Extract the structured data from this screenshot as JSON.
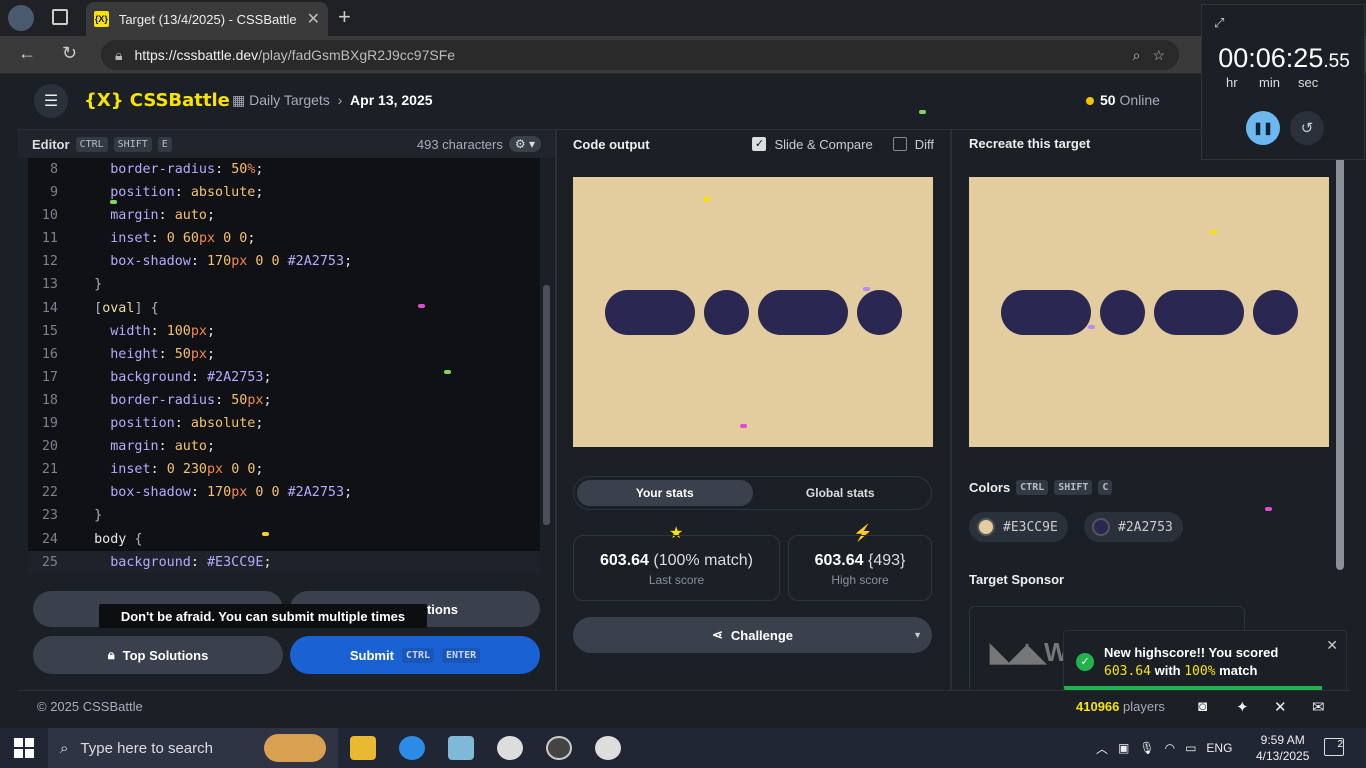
{
  "browser": {
    "tab_title": "Target (13/4/2025) - CSSBattle",
    "tab_favicon": "{X}",
    "url_host": "https://cssbattle.dev",
    "url_path": "/play/fadGsmBXgR2J9cc97SFe"
  },
  "header": {
    "logo": "{X} CSSBattle",
    "crumb_parent": "Daily Targets",
    "crumb_current": "Apr 13, 2025",
    "online_count": "50",
    "online_label": "Online"
  },
  "editor": {
    "title": "Editor",
    "shortcut": [
      "CTRL",
      "SHIFT",
      "E"
    ],
    "char_count": "493 characters",
    "lines": [
      {
        "n": "8",
        "html": "    <span class='c-prop'>border-radius</span>: <span class='c-num'>50</span><span class='c-unit'>%</span>;"
      },
      {
        "n": "9",
        "html": "    <span class='c-prop'>position</span>: <span class='c-num'>absolute</span>;"
      },
      {
        "n": "10",
        "html": "    <span class='c-prop'>margin</span>: <span class='c-num'>auto</span>;"
      },
      {
        "n": "11",
        "html": "    <span class='c-prop'>inset</span>: <span class='c-num'>0</span> <span class='c-num'>60</span><span class='c-unit'>px</span> <span class='c-num'>0</span> <span class='c-num'>0</span>;"
      },
      {
        "n": "12",
        "html": "    <span class='c-prop'>box-shadow</span>: <span class='c-num'>170</span><span class='c-unit'>px</span> <span class='c-num'>0</span> <span class='c-num'>0</span> <span class='c-hex'>#2A2753</span>;"
      },
      {
        "n": "13",
        "html": "  <span class='c-br'>}</span>"
      },
      {
        "n": "14",
        "html": "  <span class='c-br'>[</span><span class='c-sel'>oval</span><span class='c-br'>]</span> <span class='c-br'>{</span>"
      },
      {
        "n": "15",
        "html": "    <span class='c-prop'>width</span>: <span class='c-num'>100</span><span class='c-unit'>px</span>;"
      },
      {
        "n": "16",
        "html": "    <span class='c-prop'>height</span>: <span class='c-num'>50</span><span class='c-unit'>px</span>;"
      },
      {
        "n": "17",
        "html": "    <span class='c-prop'>background</span>: <span class='c-hex'>#2A2753</span>;"
      },
      {
        "n": "18",
        "html": "    <span class='c-prop'>border-radius</span>: <span class='c-num'>50</span><span class='c-unit'>px</span>;"
      },
      {
        "n": "19",
        "html": "    <span class='c-prop'>position</span>: <span class='c-num'>absolute</span>;"
      },
      {
        "n": "20",
        "html": "    <span class='c-prop'>margin</span>: <span class='c-num'>auto</span>;"
      },
      {
        "n": "21",
        "html": "    <span class='c-prop'>inset</span>: <span class='c-num'>0</span> <span class='c-num'>230</span><span class='c-unit'>px</span> <span class='c-num'>0</span> <span class='c-num'>0</span>;"
      },
      {
        "n": "22",
        "html": "    <span class='c-prop'>box-shadow</span>: <span class='c-num'>170</span><span class='c-unit'>px</span> <span class='c-num'>0</span> <span class='c-num'>0</span> <span class='c-hex'>#2A2753</span>;"
      },
      {
        "n": "23",
        "html": "  <span class='c-br'>}</span>"
      },
      {
        "n": "24",
        "html": "  <span class='c-kw'>body</span> <span class='c-br'>{</span>"
      },
      {
        "n": "25",
        "html": "    <span class='c-prop'>background</span>: <span class='c-hex'>#E3CC9E</span>;"
      }
    ],
    "tooltip": "Don't be afraid. You can submit multiple times",
    "btn2_label": "tions",
    "top_solutions": "Top Solutions",
    "submit": "Submit",
    "submit_keys": [
      "CTRL",
      "ENTER"
    ]
  },
  "output": {
    "title": "Code output",
    "slide_compare": "Slide & Compare",
    "diff": "Diff",
    "tabs": [
      "Your stats",
      "Global stats"
    ],
    "last_score": "603.64",
    "last_match": "(100% match)",
    "last_label": "Last score",
    "high_score": "603.64",
    "high_chars": "{493}",
    "high_label": "High score",
    "challenge": "Challenge"
  },
  "target": {
    "title": "Recreate this target",
    "colors_title": "Colors",
    "colors_keys": [
      "CTRL",
      "SHIFT",
      "C"
    ],
    "colors": [
      {
        "hex": "#E3CC9E"
      },
      {
        "hex": "#2A2753"
      }
    ],
    "sponsor_title": "Target Sponsor",
    "sponsor_logo": "W"
  },
  "toast": {
    "line1": "New highscore!! You scored",
    "score": "603.64",
    "with": "with",
    "match": "100%",
    "match_word": "match"
  },
  "footer": {
    "copyright": "© 2025 CSSBattle",
    "players": "410966",
    "players_label": "players"
  },
  "timer": {
    "time": "00:06:25",
    "ms": ".55",
    "units": [
      "hr",
      "min",
      "sec"
    ]
  },
  "taskbar": {
    "search_placeholder": "Type here to search",
    "lang": "ENG",
    "time": "9:59 AM",
    "date": "4/13/2025",
    "notif_count": "2"
  },
  "colors": {
    "accent": "#f9e300",
    "bg": "#E3CC9E",
    "shape": "#2A2753",
    "submit": "#1a61d4"
  }
}
